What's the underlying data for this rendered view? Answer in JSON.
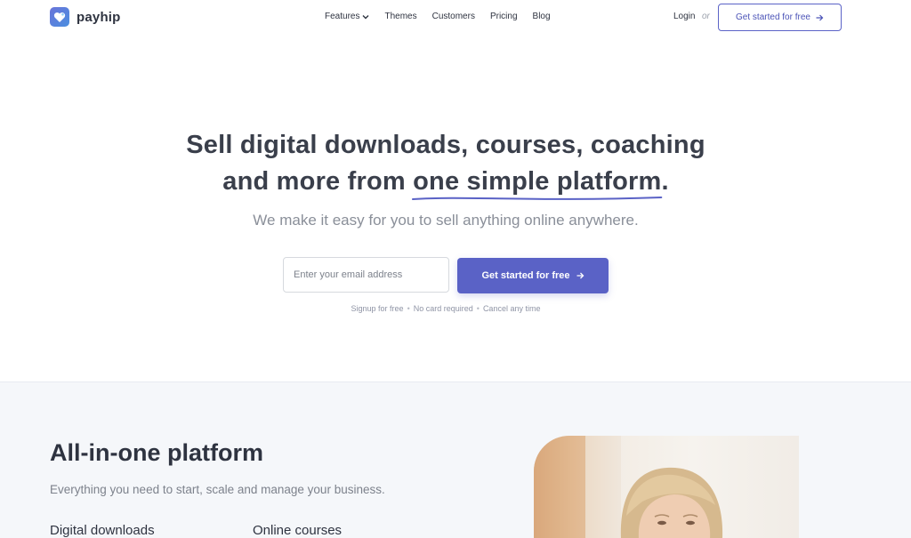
{
  "brand": {
    "name": "payhip",
    "primary_color": "#5a62c6",
    "icon": "heart-logo-icon"
  },
  "nav": {
    "items": [
      {
        "label": "Features",
        "has_dropdown": true
      },
      {
        "label": "Themes"
      },
      {
        "label": "Customers"
      },
      {
        "label": "Pricing"
      },
      {
        "label": "Blog"
      }
    ],
    "login": "Login",
    "or": "or",
    "cta": "Get started for free"
  },
  "hero": {
    "title_line1": "Sell digital downloads, courses, coaching",
    "title_line2_prefix": "and more from ",
    "title_highlight": "one simple platform",
    "title_suffix": ".",
    "subtitle": "We make it easy for you to sell anything online anywhere.",
    "email_placeholder": "Enter your email address",
    "cta": "Get started for free",
    "notes": [
      "Signup for free",
      "No card required",
      "Cancel any time"
    ]
  },
  "platform_section": {
    "title": "All-in-one platform",
    "subtitle": "Everything you need to start, scale and manage your business.",
    "features": [
      "Digital downloads",
      "Online courses"
    ],
    "background": "#f5f7fa"
  }
}
